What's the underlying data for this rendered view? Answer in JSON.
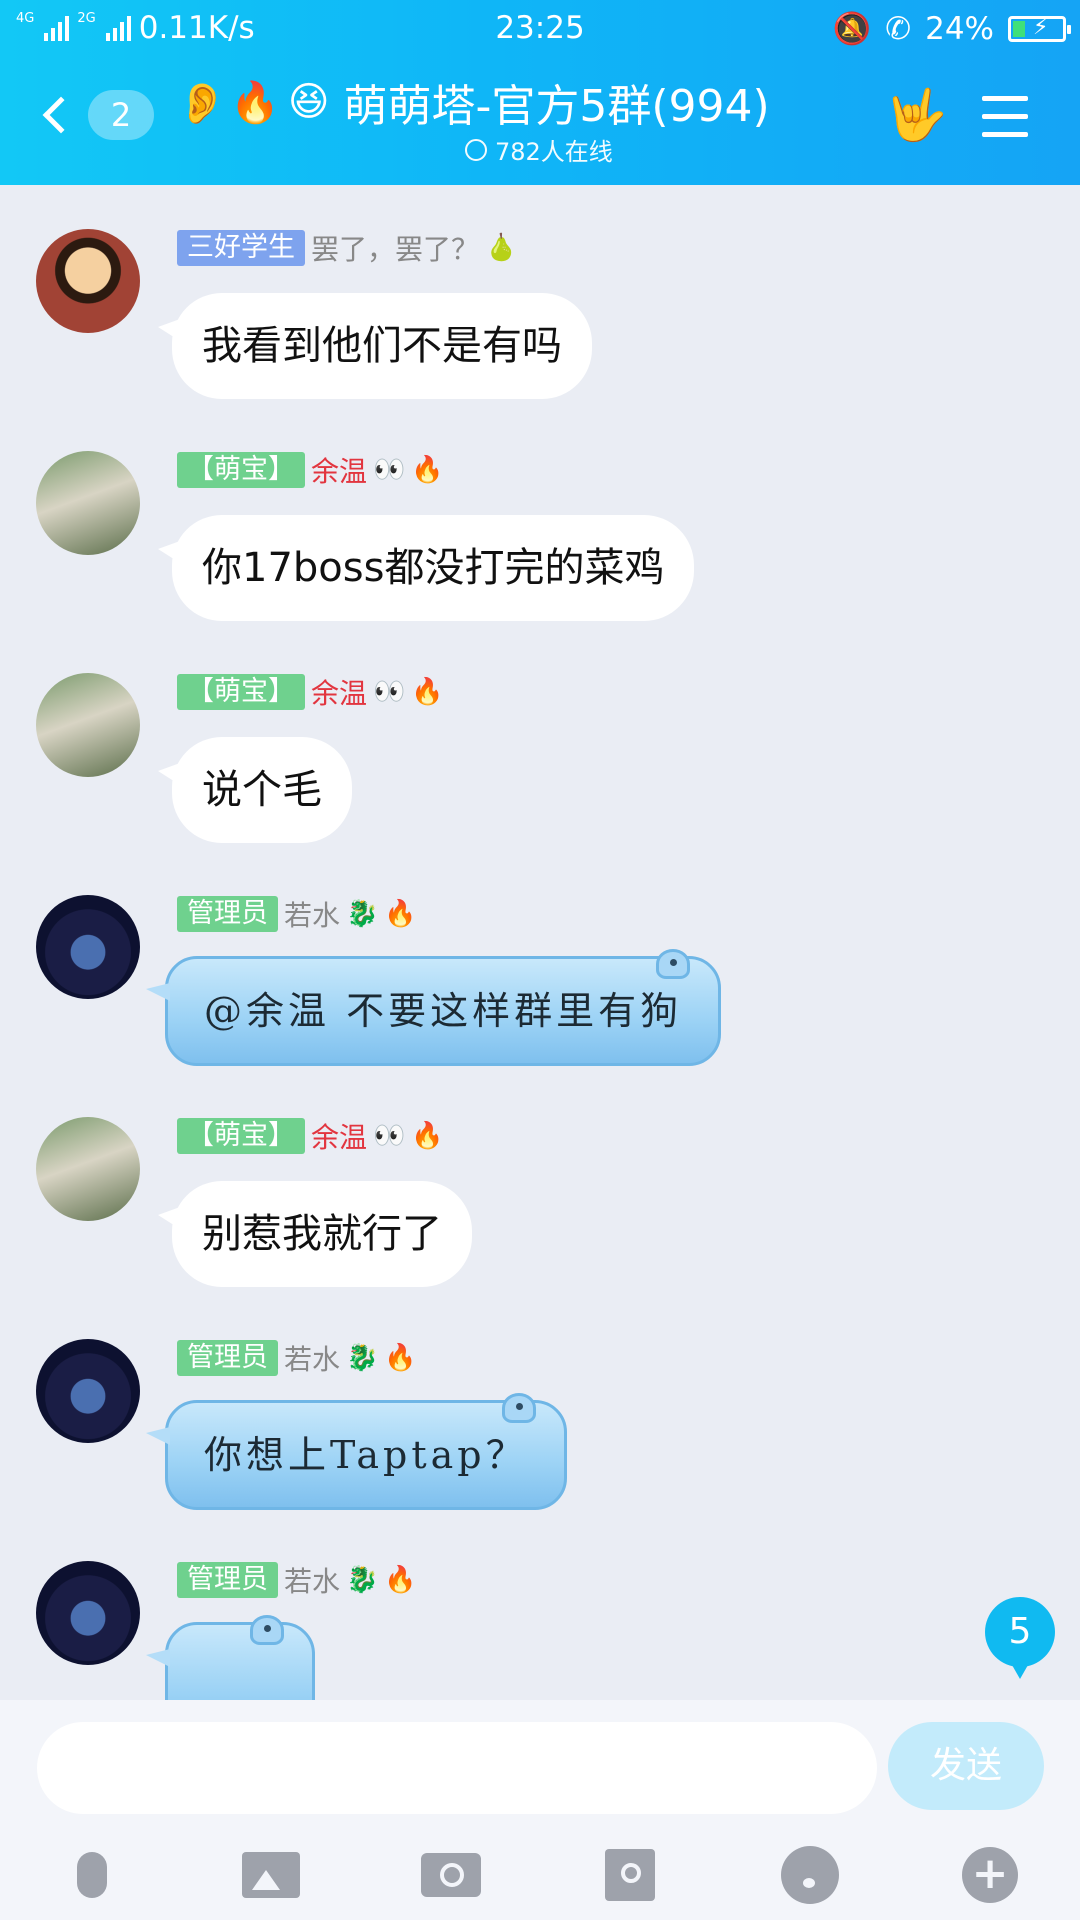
{
  "status_bar": {
    "network_label_1": "4G",
    "network_label_2": "2G",
    "speed": "0.11K/s",
    "time": "23:25",
    "battery": "24%"
  },
  "header": {
    "back_count": "2",
    "title": "萌萌塔-官方5群(994)",
    "online": "782人在线"
  },
  "messages": [
    {
      "tag": "三好学生",
      "name": "罢了，罢了？",
      "text": "我看到他们不是有吗"
    },
    {
      "tag": "【萌宝】",
      "name": "余温",
      "text": "你17boss都没打完的菜鸡"
    },
    {
      "tag": "【萌宝】",
      "name": "余温",
      "text": "说个毛"
    },
    {
      "tag": "管理员",
      "name": "若水",
      "text": "@余温 不要这样群里有狗"
    },
    {
      "tag": "【萌宝】",
      "name": "余温",
      "text": "别惹我就行了"
    },
    {
      "tag": "管理员",
      "name": "若水",
      "text": "你想上Taptap？"
    },
    {
      "tag": "管理员",
      "name": "若水",
      "text": ""
    }
  ],
  "unread_badge": "5",
  "input": {
    "placeholder": "",
    "send_label": "发送"
  },
  "icons": [
    "mic-icon",
    "image-icon",
    "camera-icon",
    "red-packet-icon",
    "emoji-icon",
    "plus-icon"
  ],
  "colors": {
    "header": "#12c8f6",
    "tag_green": "#6fd18e",
    "tag_blue": "#7ea3ee",
    "name_red": "#e2353f"
  }
}
